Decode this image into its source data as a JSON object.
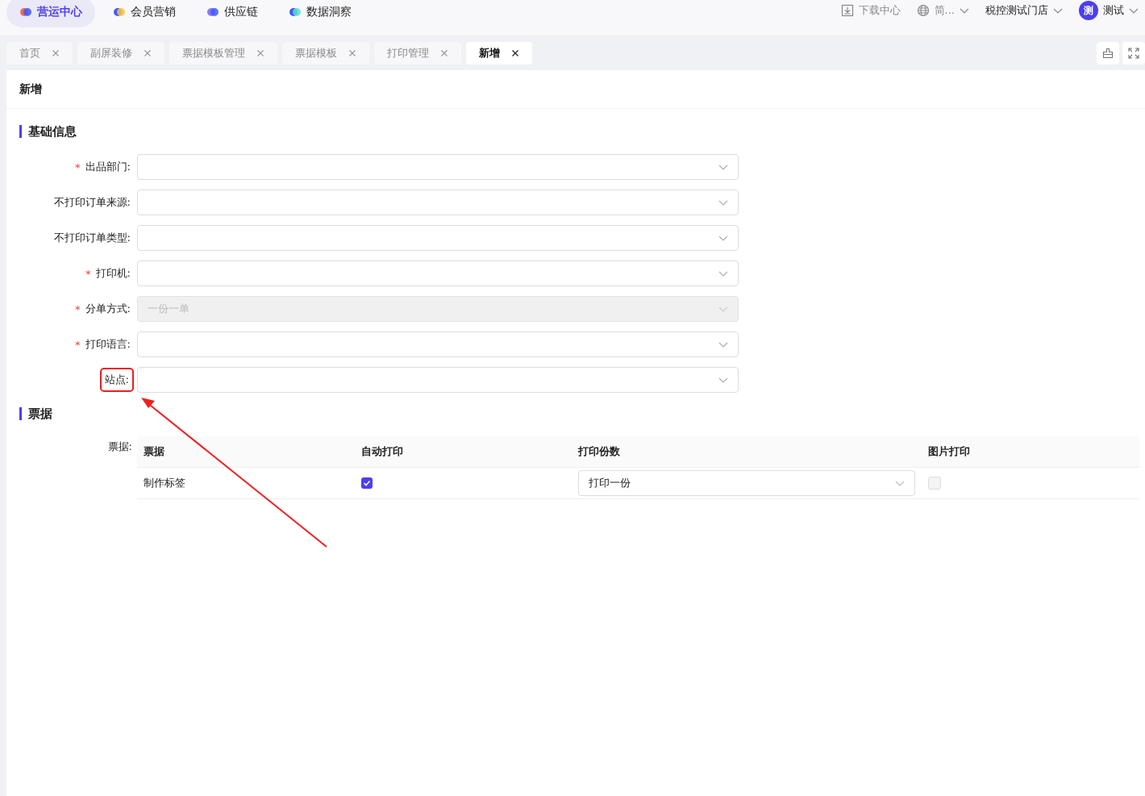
{
  "top_nav": {
    "modules": [
      {
        "label": "营运中心",
        "selected": true
      },
      {
        "label": "会员营销",
        "selected": false
      },
      {
        "label": "供应链",
        "selected": false
      },
      {
        "label": "数据洞察",
        "selected": false
      }
    ],
    "download": "下载中心",
    "language": "简...",
    "store": "税控测试门店",
    "avatar": "测",
    "user": "测试"
  },
  "tabs": [
    {
      "label": "首页",
      "selected": false
    },
    {
      "label": "副屏装修",
      "selected": false
    },
    {
      "label": "票据模板管理",
      "selected": false
    },
    {
      "label": "票据模板",
      "selected": false
    },
    {
      "label": "打印管理",
      "selected": false
    },
    {
      "label": "新增",
      "selected": true
    }
  ],
  "page_title": "新增",
  "section_basic": "基础信息",
  "fields": [
    {
      "required_mark": "*",
      "label": "出品部门:",
      "disabled": false,
      "highlighted": false
    },
    {
      "label": "不打印订单来源:",
      "disabled": false,
      "highlighted": false
    },
    {
      "label": "不打印订单类型:",
      "disabled": false,
      "highlighted": false
    },
    {
      "required_mark": "*",
      "label": "打印机:",
      "disabled": false,
      "highlighted": false
    },
    {
      "required_mark": "*",
      "label": "分单方式:",
      "disabled": true,
      "value": "一份一单",
      "highlighted": false
    },
    {
      "required_mark": "*",
      "label": "打印语言:",
      "disabled": false,
      "highlighted": false
    },
    {
      "label": "站点:",
      "disabled": false,
      "highlighted": true
    }
  ],
  "section_receipt": "票据",
  "receipt_label": "票据:",
  "table": {
    "columns": [
      "票据",
      "自动打印",
      "打印份数",
      "图片打印"
    ],
    "rows": [
      {
        "name": "制作标签",
        "auto_print": true,
        "copies": "打印一份",
        "image_print": false
      }
    ]
  }
}
